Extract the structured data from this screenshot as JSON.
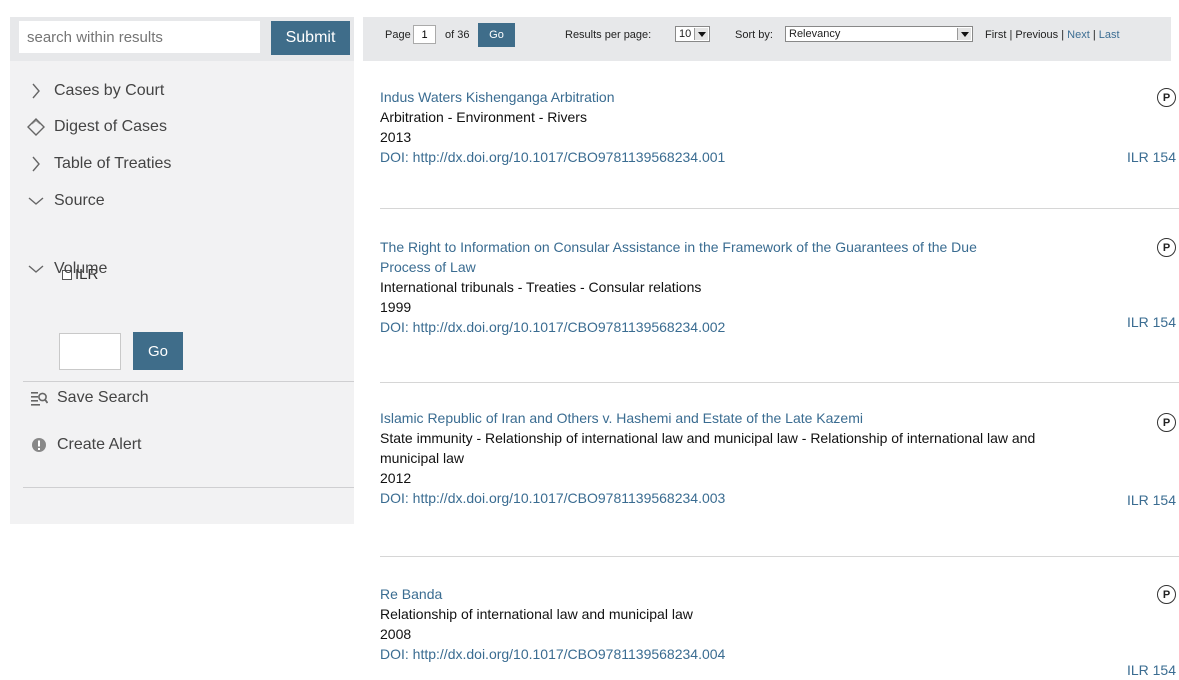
{
  "search": {
    "placeholder": "search within results",
    "submit_label": "Submit"
  },
  "sidebar": {
    "items": [
      {
        "label": "Cases by Court",
        "icon": "chevron-right-icon"
      },
      {
        "label": "Digest of Cases",
        "icon": "diamond-icon"
      },
      {
        "label": "Table of Treaties",
        "icon": "chevron-right-icon"
      },
      {
        "label": "Source",
        "icon": "chevron-down-icon"
      },
      {
        "label": "Volume",
        "icon": "chevron-down-icon"
      }
    ],
    "source_option": "ILR",
    "volume_value": "",
    "volume_go_label": "Go",
    "save_search_label": "Save Search",
    "create_alert_label": "Create Alert"
  },
  "toolbar": {
    "page_label": "Page",
    "page_value": "1",
    "of_label": "of 36",
    "go_label": "Go",
    "per_page_label": "Results per page:",
    "per_page_value": "10",
    "sort_label": "Sort by:",
    "sort_value": "Relevancy",
    "first": "First",
    "previous": "Previous",
    "next": "Next",
    "last": "Last",
    "sep": "|"
  },
  "results": [
    {
      "title": "Indus Waters Kishenganga Arbitration",
      "subjects": "Arbitration - Environment - Rivers",
      "year": "2013",
      "doi": "DOI: http://dx.doi.org/10.1017/CBO9781139568234.001",
      "source": "ILR 154",
      "badge": "P"
    },
    {
      "title": "The Right to Information on Consular Assistance in the Framework of the Guarantees of the Due Process of Law",
      "subjects": "International tribunals - Treaties - Consular relations",
      "year": "1999",
      "doi": "DOI: http://dx.doi.org/10.1017/CBO9781139568234.002",
      "source": "ILR 154",
      "badge": "P"
    },
    {
      "title": "Islamic Republic of Iran and Others v. Hashemi and Estate of the Late Kazemi",
      "subjects": "State immunity - Relationship of international law and municipal law - Relationship of international law and municipal law",
      "year": "2012",
      "doi": "DOI: http://dx.doi.org/10.1017/CBO9781139568234.003",
      "source": "ILR 154",
      "badge": "P"
    },
    {
      "title": "Re Banda",
      "subjects": "Relationship of international law and municipal law",
      "year": "2008",
      "doi": "DOI: http://dx.doi.org/10.1017/CBO9781139568234.004",
      "source": "ILR 154",
      "badge": "P"
    }
  ],
  "colors": {
    "accent": "#3f6d8a",
    "link": "#3a6c91",
    "sidebar_bg": "#f2f2f3",
    "bar_bg": "#e7e8ea"
  }
}
